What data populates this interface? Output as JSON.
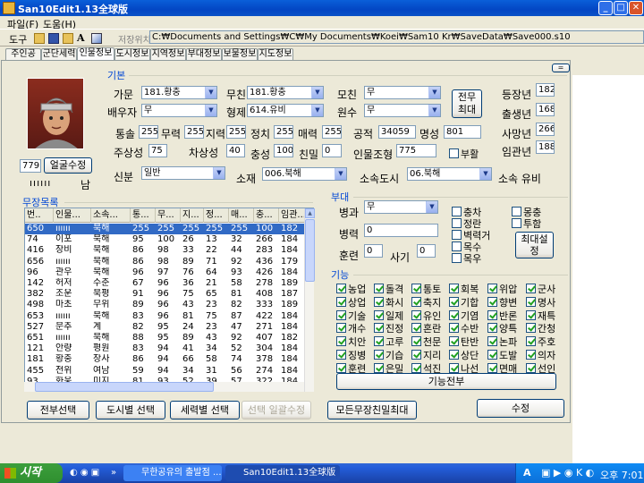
{
  "window": {
    "title": "San10Edit1.13全球版",
    "menu": [
      "파일(F)",
      "도움(H)"
    ],
    "toolbar_label": "도구",
    "path_label": "저장위치",
    "path_value": "C:₩Documents and Settings₩C₩My Documents₩Koei₩Sam10 Kr₩SaveData₩Save000.s10"
  },
  "tabs": [
    "주인공",
    "군단세력",
    "인물정보",
    "도시정보",
    "지역정보",
    "부대정보",
    "보물정보",
    "지도정보"
  ],
  "basic": {
    "group_label": "기본",
    "small_btn": "=",
    "gamun_label": "가문",
    "gamun_value": "181.황충",
    "mucheon_label": "무친",
    "mucheon_value": "181.황충",
    "mochin_label": "모친",
    "mochin_value": "무",
    "baeuja_label": "배우자",
    "baeuja_value": "무",
    "hyeongje_label": "형제",
    "hyeongje_value": "614.유비",
    "wonsu_label": "원수",
    "wonsu_value": "무",
    "jeonmu_btn": "전무\n최대",
    "deungjang_label": "등장년",
    "deungjang_value": "182",
    "chulsaeng_label": "출생년",
    "chulsaeng_value": "168",
    "samang_label": "사망년",
    "samang_value": "266",
    "imgwan_label": "임관년",
    "imgwan_value": "188",
    "tongsol_label": "통솔",
    "tongsol_value": "255",
    "muryeok_label": "무력",
    "muryeok_value": "255",
    "jiryeok_label": "지력",
    "jiryeok_value": "255",
    "jeongchi_label": "정치",
    "jeongchi_value": "255",
    "maeryeok_label": "매력",
    "maeryeok_value": "255",
    "gongjeok_label": "공적",
    "gongjeok_value": "34059",
    "myeongseong_label": "명성",
    "myeongseong_value": "801",
    "jusangsung_label": "주상성",
    "jusangsung_value": "75",
    "chasangsung_label": "차상성",
    "chasangsung_value": "40",
    "chungseong_label": "충성",
    "chungseong_value": "100",
    "chinmil_label": "친밀",
    "chinmil_value": "0",
    "inmuljohyeong_label": "인물조형",
    "inmuljohyeong_value": "775",
    "buhwal_label": "부활",
    "face_value": "779",
    "face_btn": "얼굴수정",
    "face_marks": "ıııııı",
    "gender": "남",
    "sinbun_label": "신분",
    "sinbun_value": "일반",
    "sojae_label": "소재",
    "sojae_value": "006.북해",
    "sosokdosi_label": "소속도시",
    "sosokdosi_value": "06.북해",
    "sosok_label": "소속 유비"
  },
  "general_list": {
    "group_label": "무장목록",
    "columns": [
      "번..",
      "인물...",
      "소속...",
      "통...",
      "무...",
      "지...",
      "정...",
      "매...",
      "충...",
      "임관..."
    ],
    "rows": [
      [
        "650",
        "ıııııı",
        "북해",
        "255",
        "255",
        "255",
        "255",
        "255",
        "100",
        "182"
      ],
      [
        "74",
        "이포",
        "북해",
        "95",
        "100",
        "26",
        "13",
        "32",
        "266",
        "184"
      ],
      [
        "416",
        "장비",
        "북해",
        "86",
        "98",
        "33",
        "22",
        "44",
        "283",
        "184"
      ],
      [
        "656",
        "ıııııı",
        "북해",
        "86",
        "98",
        "89",
        "71",
        "92",
        "436",
        "179"
      ],
      [
        "96",
        "관우",
        "북해",
        "96",
        "97",
        "76",
        "64",
        "93",
        "426",
        "184"
      ],
      [
        "142",
        "허저",
        "수춘",
        "67",
        "96",
        "36",
        "21",
        "58",
        "278",
        "189"
      ],
      [
        "382",
        "조운",
        "북평",
        "91",
        "96",
        "75",
        "65",
        "81",
        "408",
        "187"
      ],
      [
        "498",
        "마초",
        "무위",
        "89",
        "96",
        "43",
        "23",
        "82",
        "333",
        "189"
      ],
      [
        "653",
        "ıııııı",
        "북해",
        "83",
        "96",
        "81",
        "75",
        "87",
        "422",
        "184"
      ],
      [
        "527",
        "문추",
        "계",
        "82",
        "95",
        "24",
        "23",
        "47",
        "271",
        "184"
      ],
      [
        "651",
        "ıııııı",
        "북해",
        "88",
        "95",
        "89",
        "43",
        "92",
        "407",
        "182"
      ],
      [
        "121",
        "안량",
        "평원",
        "83",
        "94",
        "41",
        "34",
        "52",
        "304",
        "184"
      ],
      [
        "181",
        "황충",
        "장사",
        "86",
        "94",
        "66",
        "58",
        "74",
        "378",
        "184"
      ],
      [
        "455",
        "전위",
        "여남",
        "59",
        "94",
        "34",
        "31",
        "56",
        "274",
        "184"
      ],
      [
        "93",
        "화웅",
        "미지",
        "81",
        "93",
        "52",
        "39",
        "57",
        "322",
        "184"
      ]
    ]
  },
  "buttons_bottom": {
    "jeonmu_select": "전부선택",
    "dosi_select": "도시별 선택",
    "seryeok_select": "세력별 선택",
    "ilgwal_edit": "선택 일괄수정",
    "chinmil_max": "모든무장친밀최대",
    "edit": "수정"
  },
  "unit": {
    "group_label": "부대",
    "byeonggwa_label": "병과",
    "byeonggwa_value": "무",
    "byeongryeok_label": "병력",
    "byeongryeok_value": "0",
    "hunryeon_label": "훈련",
    "hunryeon_value": "0",
    "sagi_label": "사기",
    "sagi_value": "0",
    "checks": [
      "충차",
      "정란",
      "벽력거",
      "목수",
      "목우",
      "몽충",
      "투함"
    ],
    "max_btn": "최대설정"
  },
  "skills": {
    "group_label": "기능",
    "items": [
      "농업",
      "돌격",
      "통토",
      "회복",
      "위압",
      "군사",
      "상업",
      "화시",
      "축지",
      "기합",
      "향변",
      "명사",
      "기술",
      "일제",
      "유인",
      "기염",
      "반론",
      "재특",
      "개수",
      "진정",
      "혼란",
      "수반",
      "양특",
      "간청",
      "치안",
      "고루",
      "천문",
      "탄반",
      "논파",
      "주호",
      "징병",
      "기습",
      "지리",
      "상단",
      "도발",
      "의자",
      "훈련",
      "은밀",
      "석진",
      "나선",
      "면매",
      "선인"
    ],
    "all_btn": "기능전부"
  },
  "taskbar": {
    "start": "시작",
    "task1": "무한공유의 출발점 ...",
    "task2": "San10Edit1.13全球版",
    "clock": "오후 7:01"
  }
}
